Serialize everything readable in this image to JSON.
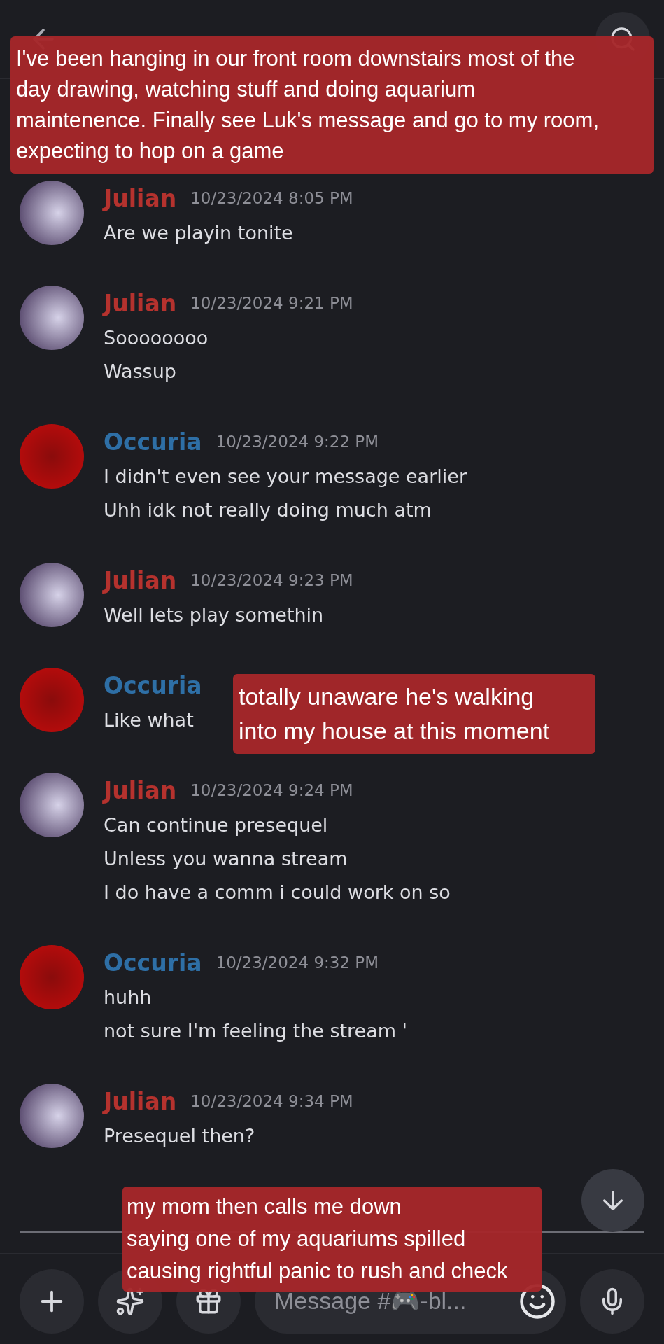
{
  "messages": [
    {
      "author": "Julian",
      "color": "#b5322e",
      "timestamp": "10/23/2024 8:05 PM",
      "lines": [
        "Are we playin tonite"
      ]
    },
    {
      "author": "Julian",
      "color": "#b5322e",
      "timestamp": "10/23/2024 9:21 PM",
      "lines": [
        "Soooooooo",
        "Wassup"
      ]
    },
    {
      "author": "Occuria",
      "color": "#2e6fa6",
      "timestamp": "10/23/2024 9:22 PM",
      "lines": [
        "I didn't even see your message earlier",
        "Uhh idk not really doing much atm"
      ]
    },
    {
      "author": "Julian",
      "color": "#b5322e",
      "timestamp": "10/23/2024 9:23 PM",
      "lines": [
        "Well lets play somethin"
      ]
    },
    {
      "author": "Occuria",
      "color": "#2e6fa6",
      "lines": [
        "Like what"
      ]
    },
    {
      "author": "Julian",
      "color": "#b5322e",
      "timestamp": "10/23/2024 9:24 PM",
      "lines": [
        "Can continue presequel",
        "Unless you wanna stream",
        "I do have a comm i could work on so"
      ]
    },
    {
      "author": "Occuria",
      "color": "#2e6fa6",
      "timestamp": "10/23/2024 9:32 PM",
      "lines": [
        "huhh",
        "not sure I'm feeling the stream '"
      ]
    },
    {
      "author": "Julian",
      "color": "#b5322e",
      "timestamp": "10/23/2024 9:34 PM",
      "lines": [
        "Presequel then?"
      ]
    }
  ],
  "composer": {
    "placeholder": "Message #🎮-bl..."
  },
  "annotations": [
    {
      "kind": "top",
      "lines": [
        "I've been hanging in our front room downstairs most of the",
        "day drawing, watching stuff and doing aquarium",
        "maintenence. Finally see Luk's message and go to my room,",
        "expecting to hop on a game"
      ]
    },
    {
      "kind": "middle",
      "lines": [
        "totally unaware he's walking",
        "into my house at this moment"
      ]
    },
    {
      "kind": "bottom",
      "lines": [
        "my mom then calls me down",
        "saying one of my aquariums spilled",
        "causing rightful panic to rush and check"
      ]
    }
  ]
}
